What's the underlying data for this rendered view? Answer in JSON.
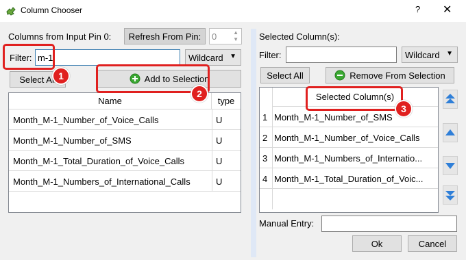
{
  "window": {
    "title": "Column Chooser",
    "help_glyph": "?",
    "close_glyph": "✕"
  },
  "left": {
    "columns_label": "Columns from Input Pin 0:",
    "refresh_label": "Refresh From Pin:",
    "pin_value": "0",
    "filter_label": "Filter:",
    "filter_value": "m-1",
    "filter_mode": "Wildcard",
    "select_all_label": "Select All",
    "add_label": "Add to Selection",
    "table": {
      "headers": [
        "Name",
        "type"
      ],
      "rows": [
        {
          "name": "Month_M-1_Number_of_Voice_Calls",
          "type": "U"
        },
        {
          "name": "Month_M-1_Number_of_SMS",
          "type": "U"
        },
        {
          "name": "Month_M-1_Total_Duration_of_Voice_Calls",
          "type": "U"
        },
        {
          "name": "Month_M-1_Numbers_of_International_Calls",
          "type": "U"
        }
      ]
    }
  },
  "right": {
    "selected_label": "Selected Column(s):",
    "filter_label": "Filter:",
    "filter_value": "",
    "filter_mode": "Wildcard",
    "select_all_label": "Select All",
    "remove_label": "Remove From Selection",
    "table": {
      "header": "Selected Column(s)",
      "rows": [
        {
          "index": "1",
          "name": "Month_M-1_Number_of_SMS"
        },
        {
          "index": "2",
          "name": "Month_M-1_Number_of_Voice_Calls"
        },
        {
          "index": "3",
          "name": "Month_M-1_Numbers_of_Internatio..."
        },
        {
          "index": "4",
          "name": "Month_M-1_Total_Duration_of_Voic..."
        }
      ]
    },
    "manual_entry_label": "Manual Entry:",
    "manual_entry_value": ""
  },
  "footer": {
    "ok_label": "Ok",
    "cancel_label": "Cancel"
  },
  "callouts": [
    "1",
    "2",
    "3"
  ],
  "colors": {
    "callout": "#e0201f",
    "add_icon": "#3aa832",
    "move_arrows": "#2f7fd8"
  }
}
